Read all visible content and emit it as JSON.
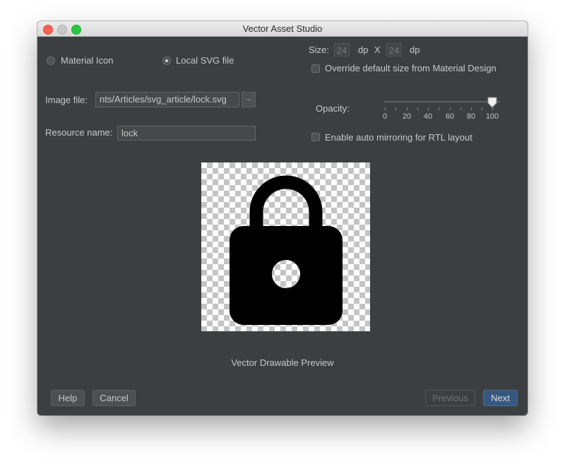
{
  "window": {
    "title": "Vector Asset Studio"
  },
  "source": {
    "material_icon_label": "Material Icon",
    "local_svg_label": "Local SVG file",
    "selected": "Local SVG file"
  },
  "image_file": {
    "label": "Image file:",
    "value": "nts/Articles/svg_article/lock.svg",
    "browse_label": "..."
  },
  "resource_name": {
    "label": "Resource name:",
    "value": "lock"
  },
  "size": {
    "label": "Size:",
    "width": "24",
    "height": "24",
    "unit_w": "dp",
    "separator": "X",
    "unit_h": "dp"
  },
  "override": {
    "label": "Override default size from Material Design",
    "checked": false
  },
  "opacity": {
    "label": "Opacity:",
    "value": 100,
    "ticks": [
      "0",
      "20",
      "40",
      "60",
      "80",
      "100"
    ]
  },
  "rtl": {
    "label": "Enable auto mirroring for RTL layout",
    "checked": false
  },
  "preview": {
    "caption": "Vector Drawable Preview",
    "icon": "lock-icon"
  },
  "buttons": {
    "help": "Help",
    "cancel": "Cancel",
    "previous": "Previous",
    "next": "Next"
  },
  "colors": {
    "background": "#3c3f41",
    "accent": "#365880"
  }
}
